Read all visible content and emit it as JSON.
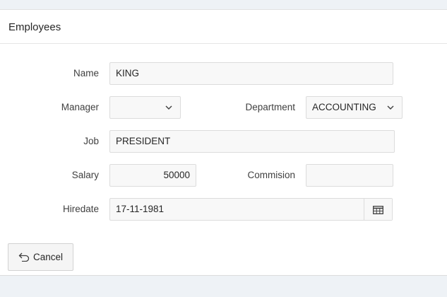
{
  "region": {
    "title": "Employees"
  },
  "form": {
    "name": {
      "label": "Name",
      "value": "KING"
    },
    "manager": {
      "label": "Manager",
      "value": ""
    },
    "department": {
      "label": "Department",
      "value": "ACCOUNTING"
    },
    "job": {
      "label": "Job",
      "value": "PRESIDENT"
    },
    "salary": {
      "label": "Salary",
      "value": "50000"
    },
    "commission": {
      "label": "Commision",
      "value": ""
    },
    "hiredate": {
      "label": "Hiredate",
      "value": "17-11-1981"
    }
  },
  "actions": {
    "cancel_label": "Cancel"
  },
  "icons": {
    "manager_dropdown": "chevron-down-icon",
    "department_dropdown": "chevron-down-icon",
    "hiredate_picker": "calendar-icon",
    "cancel": "undo-arrow-icon"
  },
  "colors": {
    "page_background": "#eef2f6",
    "region_background": "#ffffff",
    "field_background": "#f8f8f8",
    "field_border": "#dcdcdc",
    "button_background": "#f5f5f5"
  }
}
